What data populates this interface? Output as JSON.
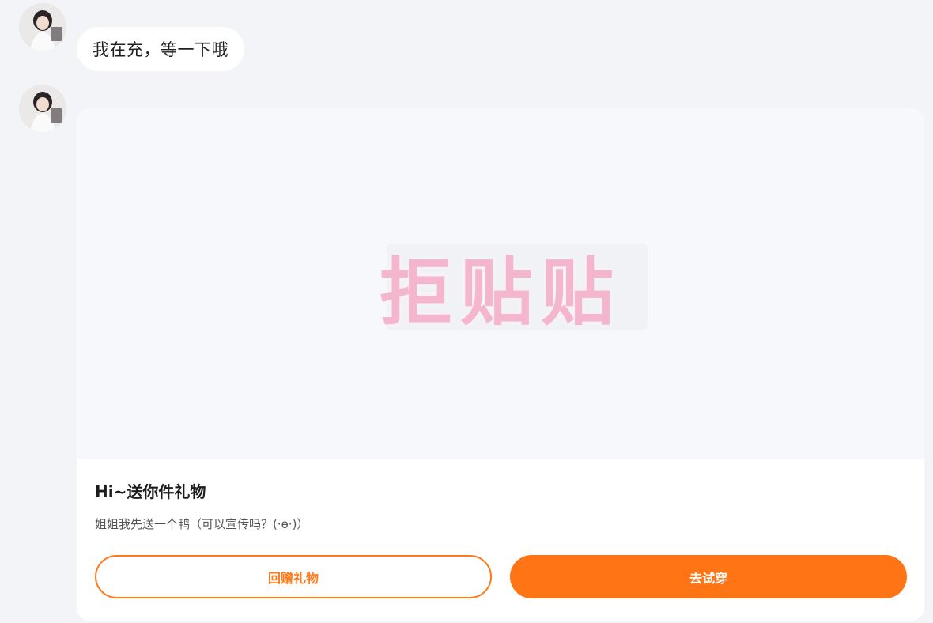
{
  "messages": [
    {
      "type": "text",
      "text": "我在充，等一下哦"
    },
    {
      "type": "gift_card",
      "sticker_text": "拒贴贴",
      "title": "Hi~送你件礼物",
      "description": "姐姐我先送一个鸭（可以宣传吗？(·ө·)）",
      "buttons": {
        "return_gift": "回赠礼物",
        "try_on": "去试穿"
      }
    }
  ],
  "colors": {
    "accent": "#ff7414",
    "background": "#f3f4f7",
    "sticker_pink": "#f3b6cc"
  }
}
